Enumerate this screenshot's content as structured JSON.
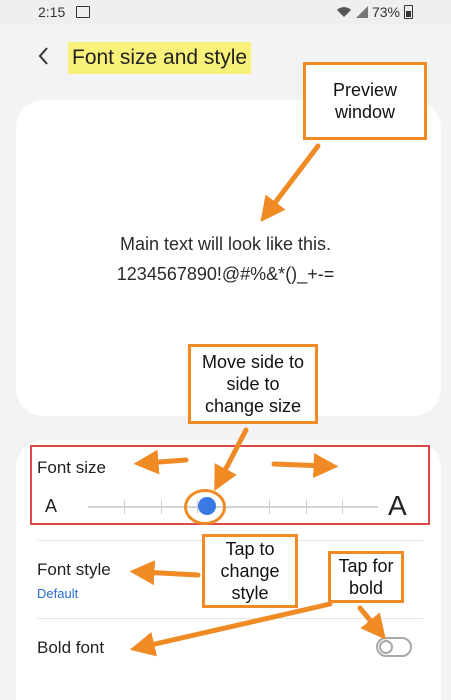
{
  "status_bar": {
    "time": "2:15",
    "battery": "73%"
  },
  "header": {
    "title": "Font size and style",
    "back_icon": "chevron-left-icon"
  },
  "preview": {
    "line1": "Main text will look like this.",
    "line2": "1234567890!@#%&*()_+-="
  },
  "font_size": {
    "label": "Font size",
    "small_glyph": "A",
    "large_glyph": "A",
    "selected_step": 4,
    "total_steps": 8
  },
  "font_style": {
    "label": "Font style",
    "value": "Default"
  },
  "bold_font": {
    "label": "Bold font",
    "enabled": false
  },
  "annotations": {
    "preview_window": "Preview\nwindow",
    "move_slider": "Move side to\nside to\nchange size",
    "tap_style": "Tap to\nchange\nstyle",
    "tap_bold": "Tap for\nbold"
  },
  "colors": {
    "accent": "#3a78e3",
    "annotation_orange": "#f08a24",
    "highlight": "#f9f27a",
    "red_box": "#e04747"
  }
}
